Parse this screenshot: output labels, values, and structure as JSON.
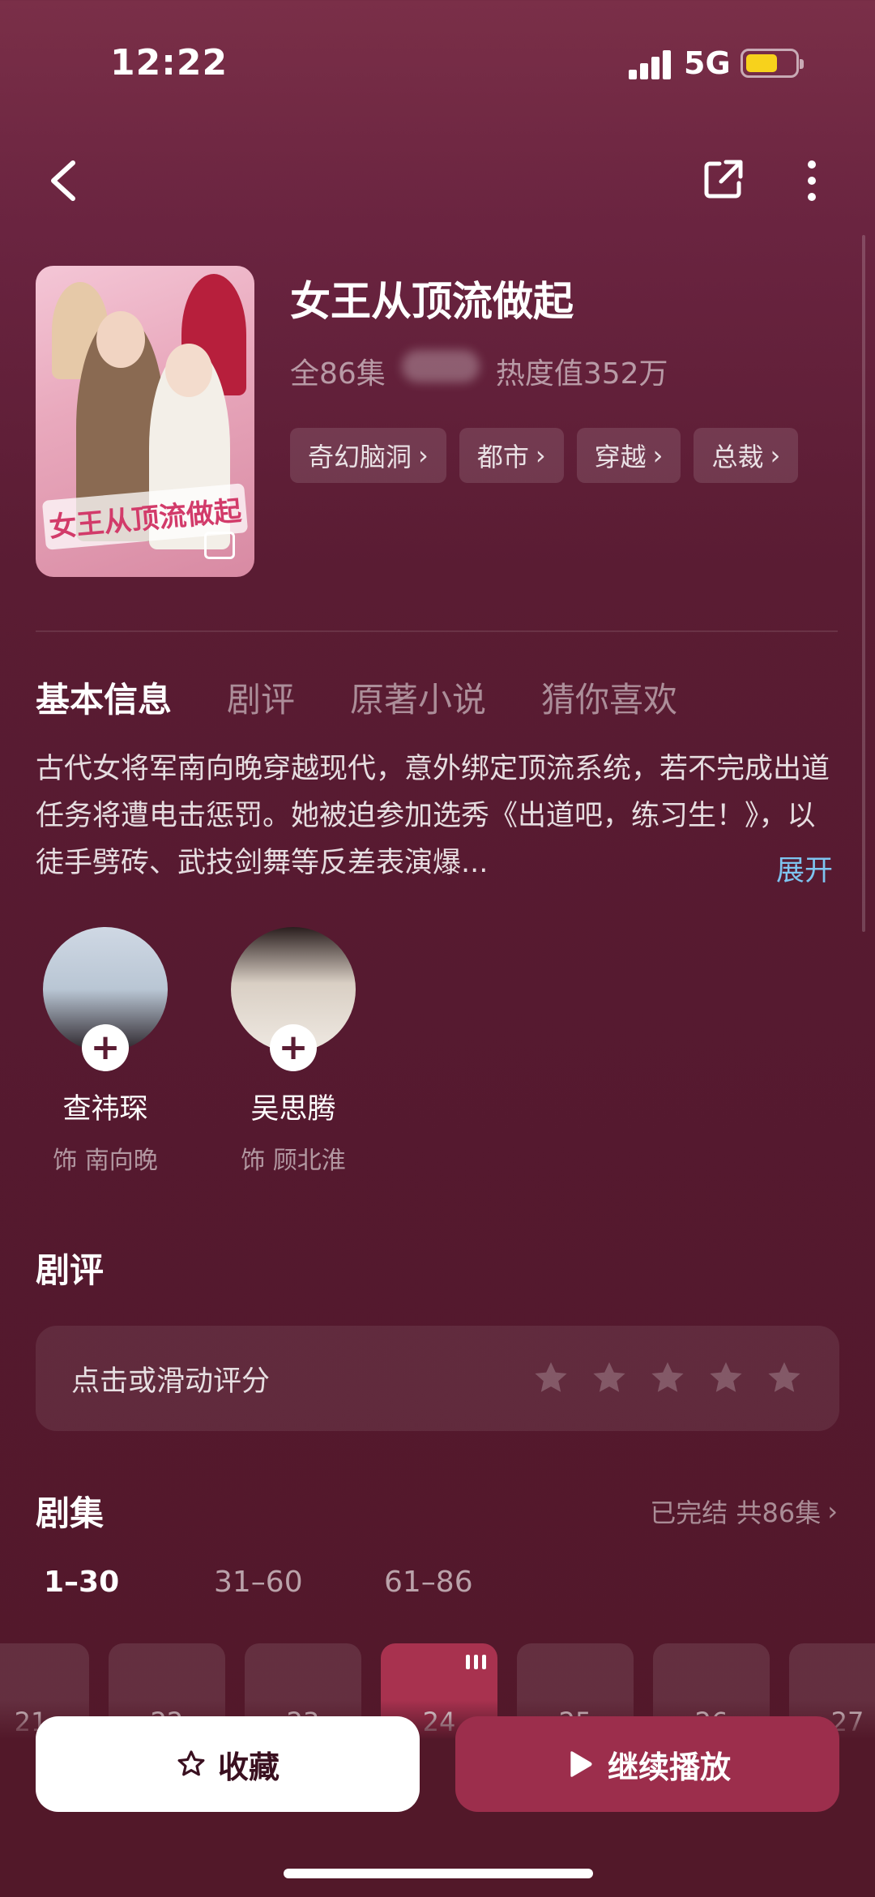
{
  "status_bar": {
    "time": "12:22",
    "network": "5G"
  },
  "drama": {
    "title": "女王从顶流做起",
    "episodes_total": "全86集",
    "heat": "热度值352万",
    "poster_title": "女王从顶流做起",
    "tags": [
      "奇幻脑洞",
      "都市",
      "穿越",
      "总裁"
    ]
  },
  "tabs": [
    "基本信息",
    "剧评",
    "原著小说",
    "猜你喜欢"
  ],
  "description": "古代女将军南向晚穿越现代，意外绑定顶流系统，若不完成出道任务将遭电击惩罚。她被迫参加选秀《出道吧，练习生！》，以徒手劈砖、武技剑舞等反差表演爆...",
  "expand_label": "展开",
  "cast": [
    {
      "name": "查祎琛",
      "role": "饰 南向晚"
    },
    {
      "name": "吴思腾",
      "role": "饰 顾北淮"
    }
  ],
  "review": {
    "title": "剧评",
    "prompt": "点击或滑动评分",
    "max_stars": 5
  },
  "episodes": {
    "title": "剧集",
    "summary": "已完结 共86集",
    "ranges": [
      "1–30",
      "31–60",
      "61–86"
    ],
    "active_range": 0,
    "visible": [
      "21",
      "22",
      "23",
      "24",
      "25",
      "26",
      "27"
    ],
    "current": "24"
  },
  "actions": {
    "favorite": "收藏",
    "continue": "继续播放"
  },
  "colors": {
    "accent": "#a8324f",
    "link": "#7ec4f0",
    "background": "#55192f"
  }
}
